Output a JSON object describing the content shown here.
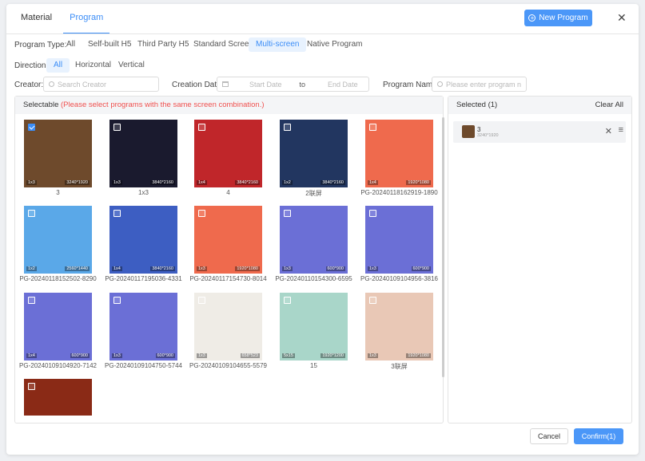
{
  "tabs": [
    {
      "label": "Material",
      "active": false
    },
    {
      "label": "Program",
      "active": true
    }
  ],
  "new_program_label": "New Program",
  "filters": {
    "program_type_label": "Program Type:",
    "program_types": [
      {
        "label": "All",
        "active": false
      },
      {
        "label": "Self-built H5",
        "active": false
      },
      {
        "label": "Third Party H5",
        "active": false
      },
      {
        "label": "Standard Screen",
        "active": false
      },
      {
        "label": "Multi-screen",
        "active": true
      },
      {
        "label": "Native Program",
        "active": false
      }
    ],
    "direction_label": "Direction:",
    "directions": [
      {
        "label": "All",
        "active": true
      },
      {
        "label": "Horizontal",
        "active": false
      },
      {
        "label": "Vertical",
        "active": false
      }
    ],
    "creator_label": "Creator:",
    "creator_placeholder": "Search Creator",
    "creation_date_label": "Creation Date:",
    "start_date_placeholder": "Start Date",
    "to_label": "to",
    "end_date_placeholder": "End Date",
    "program_name_label": "Program Name:",
    "program_name_placeholder": "Please enter program n"
  },
  "selectable": {
    "title": "Selectable",
    "warning": "(Please select programs with the same screen combination.)",
    "items": [
      {
        "name": "3",
        "layout": "1x3",
        "res": "3240*1920",
        "checked": true,
        "bg": "#6e4a2c"
      },
      {
        "name": "1x3",
        "layout": "1x3",
        "res": "3840*2160",
        "checked": false,
        "bg": "#1a1a2e"
      },
      {
        "name": "4",
        "layout": "1x4",
        "res": "3840*2160",
        "checked": false,
        "bg": "#c0262a"
      },
      {
        "name": "2联屏",
        "layout": "1x2",
        "res": "3840*2160",
        "checked": false,
        "bg": "#223660"
      },
      {
        "name": "PG-20240118162919-1890",
        "layout": "1x4",
        "res": "1920*1080",
        "checked": false,
        "bg": "#ef6a4d"
      },
      {
        "name": "PG-20240118152502-8290",
        "layout": "1x2",
        "res": "2560*1440",
        "checked": false,
        "bg": "#5aa8e8"
      },
      {
        "name": "PG-20240117195036-4331",
        "layout": "1x4",
        "res": "3840*2160",
        "checked": false,
        "bg": "#3d5ec2"
      },
      {
        "name": "PG-20240117154730-8014",
        "layout": "1x3",
        "res": "1920*1080",
        "checked": false,
        "bg": "#ef6a4d"
      },
      {
        "name": "PG-20240110154300-6595",
        "layout": "1x3",
        "res": "600*900",
        "checked": false,
        "bg": "#6b6fd6"
      },
      {
        "name": "PG-20240109104956-3816",
        "layout": "1x3",
        "res": "600*900",
        "checked": false,
        "bg": "#6b6fd6"
      },
      {
        "name": "PG-20240109104920-7142",
        "layout": "1x4",
        "res": "600*900",
        "checked": false,
        "bg": "#6b6fd6"
      },
      {
        "name": "PG-20240109104750-5744",
        "layout": "1x3",
        "res": "600*900",
        "checked": false,
        "bg": "#6b6fd6"
      },
      {
        "name": "PG-20240109104655-5579",
        "layout": "1x3",
        "res": "658*523",
        "checked": false,
        "bg": "#efece6"
      },
      {
        "name": "15",
        "layout": "5x15",
        "res": "1920*1200",
        "checked": false,
        "bg": "#a9d6c9"
      },
      {
        "name": "3联屏",
        "layout": "1x3",
        "res": "1920*1080",
        "checked": false,
        "bg": "#e9c8b6"
      },
      {
        "name": "",
        "layout": "",
        "res": "",
        "checked": false,
        "bg": "#8a2a16"
      }
    ]
  },
  "selected": {
    "title": "Selected (1)",
    "clear_all": "Clear All",
    "items": [
      {
        "name": "3",
        "res": "3240*1920"
      }
    ]
  },
  "cancel_label": "Cancel",
  "confirm_label": "Confirm(1)",
  "colors": {
    "accent": "#4b97f8",
    "warning": "#f0514f"
  }
}
